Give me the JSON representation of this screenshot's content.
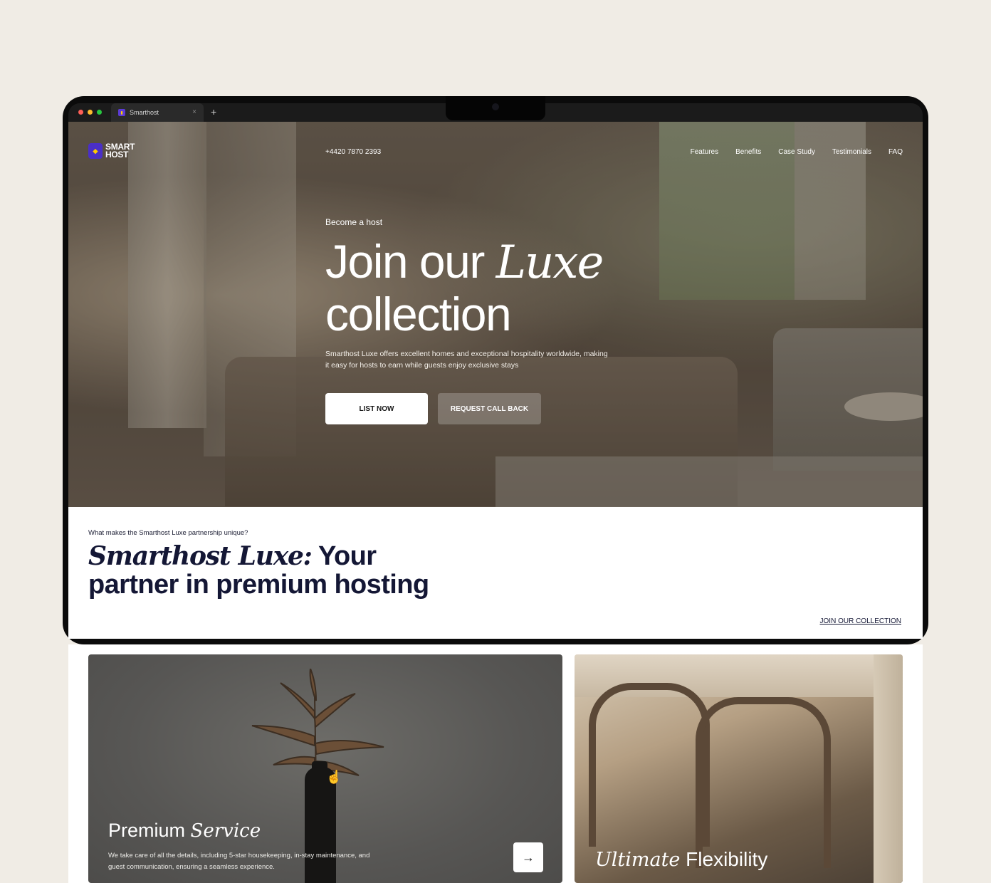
{
  "browser": {
    "tab_title": "Smarthost",
    "new_tab": "+",
    "close": "×"
  },
  "brand": {
    "logo_line1": "SMART",
    "logo_line2": "HOST",
    "accent": "#4a2fc7"
  },
  "header": {
    "phone": "+4420 7870 2393",
    "nav": [
      "Features",
      "Benefits",
      "Case Study",
      "Testimonials",
      "FAQ"
    ]
  },
  "hero": {
    "eyebrow": "Become a host",
    "title_plain_1": "Join our ",
    "title_italic": "Luxe",
    "title_plain_2": "collection",
    "lead": "Smarthost Luxe offers excellent homes and exceptional hospitality worldwide, making it easy for hosts to earn while guests enjoy exclusive stays",
    "cta_primary": "LIST NOW",
    "cta_secondary": "REQUEST CALL BACK"
  },
  "section": {
    "eyebrow": "What makes the Smarthost Luxe partnership unique?",
    "title_italic": "Smarthost Luxe:",
    "title_rest_1": " Your",
    "title_rest_2": "partner in premium hosting",
    "link": "JOIN OUR COLLECTION"
  },
  "cards": [
    {
      "title_plain": "Premium ",
      "title_italic": "Service",
      "body": "We take care of all the details, including 5-star housekeeping, in-stay maintenance, and guest communication, ensuring a seamless experience.",
      "icon": "arrow-right-icon"
    },
    {
      "title_italic": "Ultimate",
      "title_plain": " Flexibility"
    }
  ]
}
